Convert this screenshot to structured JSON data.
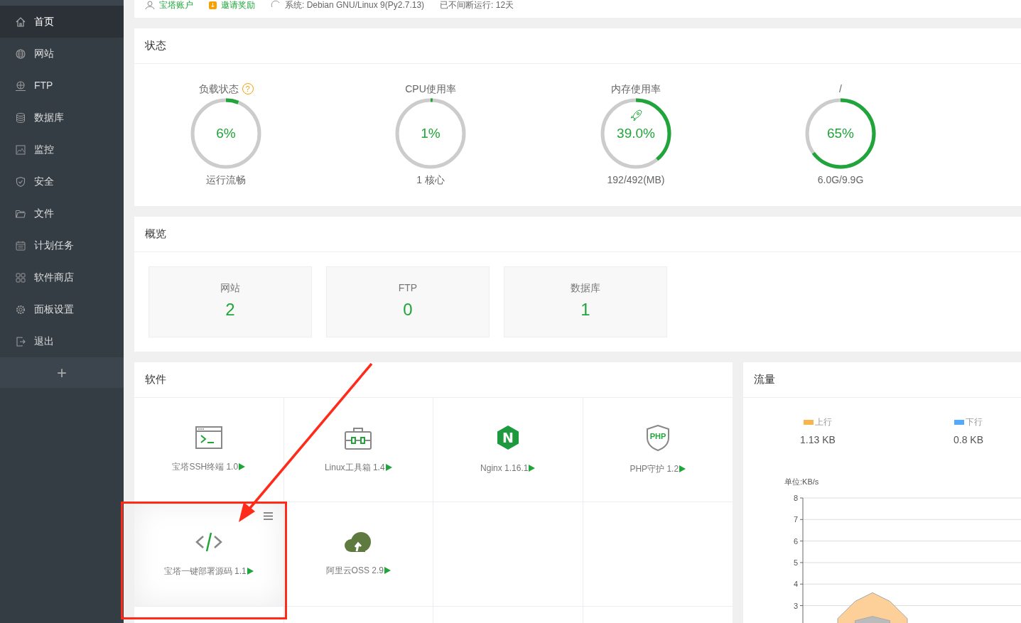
{
  "top_bar": [
    {
      "kind": "account",
      "text": "宝塔账户"
    },
    {
      "kind": "invite",
      "text": "邀请奖励"
    },
    {
      "kind": "system",
      "text": "系统: Debian GNU/Linux 9(Py2.7.13)"
    },
    {
      "kind": "uptime",
      "text": "已不间断运行: 12天"
    }
  ],
  "sidebar": {
    "items": [
      {
        "label": "首页",
        "selected": true
      },
      {
        "label": "网站",
        "selected": false
      },
      {
        "label": "FTP",
        "selected": false
      },
      {
        "label": "数据库",
        "selected": false
      },
      {
        "label": "监控",
        "selected": false
      },
      {
        "label": "安全",
        "selected": false
      },
      {
        "label": "文件",
        "selected": false
      },
      {
        "label": "计划任务",
        "selected": false
      },
      {
        "label": "软件商店",
        "selected": false
      },
      {
        "label": "面板设置",
        "selected": false
      },
      {
        "label": "退出",
        "selected": false
      }
    ],
    "add_button": "+"
  },
  "status": {
    "title": "状态",
    "gauges": [
      {
        "label": "负载状态",
        "help": "?",
        "level": 0.06,
        "value": "6%",
        "detail": "运行流畅",
        "rocket": false
      },
      {
        "label": "CPU使用率",
        "level": 0.01,
        "value": "1%",
        "detail": "1 核心",
        "rocket": false
      },
      {
        "label": "内存使用率",
        "level": 0.39,
        "value": "39.0%",
        "detail": "192/492(MB)",
        "rocket": true
      },
      {
        "label": "/",
        "level": 0.65,
        "value": "65%",
        "detail": "6.0G/9.9G",
        "rocket": false
      }
    ]
  },
  "overview": {
    "title": "概览",
    "tiles": [
      {
        "label": "网站",
        "value": "2"
      },
      {
        "label": "FTP",
        "value": "0"
      },
      {
        "label": "数据库",
        "value": "1"
      }
    ]
  },
  "software": {
    "title": "软件",
    "items": [
      {
        "name": "宝塔SSH终端 1.0",
        "kind": "terminal",
        "hovered": false
      },
      {
        "name": "Linux工具箱 1.4",
        "kind": "toolbox",
        "hovered": false
      },
      {
        "name": "Nginx 1.16.1",
        "kind": "hexagon",
        "icon_text": "N",
        "hovered": false
      },
      {
        "name": "PHP守护 1.2",
        "kind": "shield",
        "icon_text": "PHP",
        "hovered": false
      },
      {
        "name": "宝塔一键部署源码 1.1",
        "kind": "code",
        "hovered": true
      },
      {
        "name": "阿里云OSS 2.9",
        "kind": "cloud",
        "hovered": false
      }
    ]
  },
  "traffic": {
    "title": "流量",
    "legend": [
      {
        "color": "#f9b54c",
        "value": "1.13 KB"
      },
      {
        "color": "#52a9ff",
        "value": "0.8 KB"
      }
    ],
    "chart_data": {
      "type": "area",
      "ylabel": "单位:KB/s",
      "categories": [
        null,
        null,
        null,
        null,
        null,
        null,
        null,
        null,
        null,
        null,
        null,
        null,
        null
      ],
      "ylim": [
        2.16,
        8
      ],
      "yticks": [
        3,
        4,
        5,
        6,
        7,
        8
      ],
      "grid": true,
      "series": [
        {
          "name": "上行",
          "color": "#fdd09a",
          "values": [
            null,
            null,
            2.4,
            3.2,
            3.6,
            3.2,
            2.4,
            null,
            null,
            null,
            null,
            null,
            null
          ]
        },
        {
          "name": "下行",
          "color": "#bbbbbb",
          "values": [
            null,
            null,
            null,
            2.3,
            2.5,
            2.3,
            null,
            null,
            null,
            null,
            null,
            null,
            null
          ]
        }
      ]
    }
  },
  "annotation": {
    "frame": true,
    "arrow": true
  }
}
